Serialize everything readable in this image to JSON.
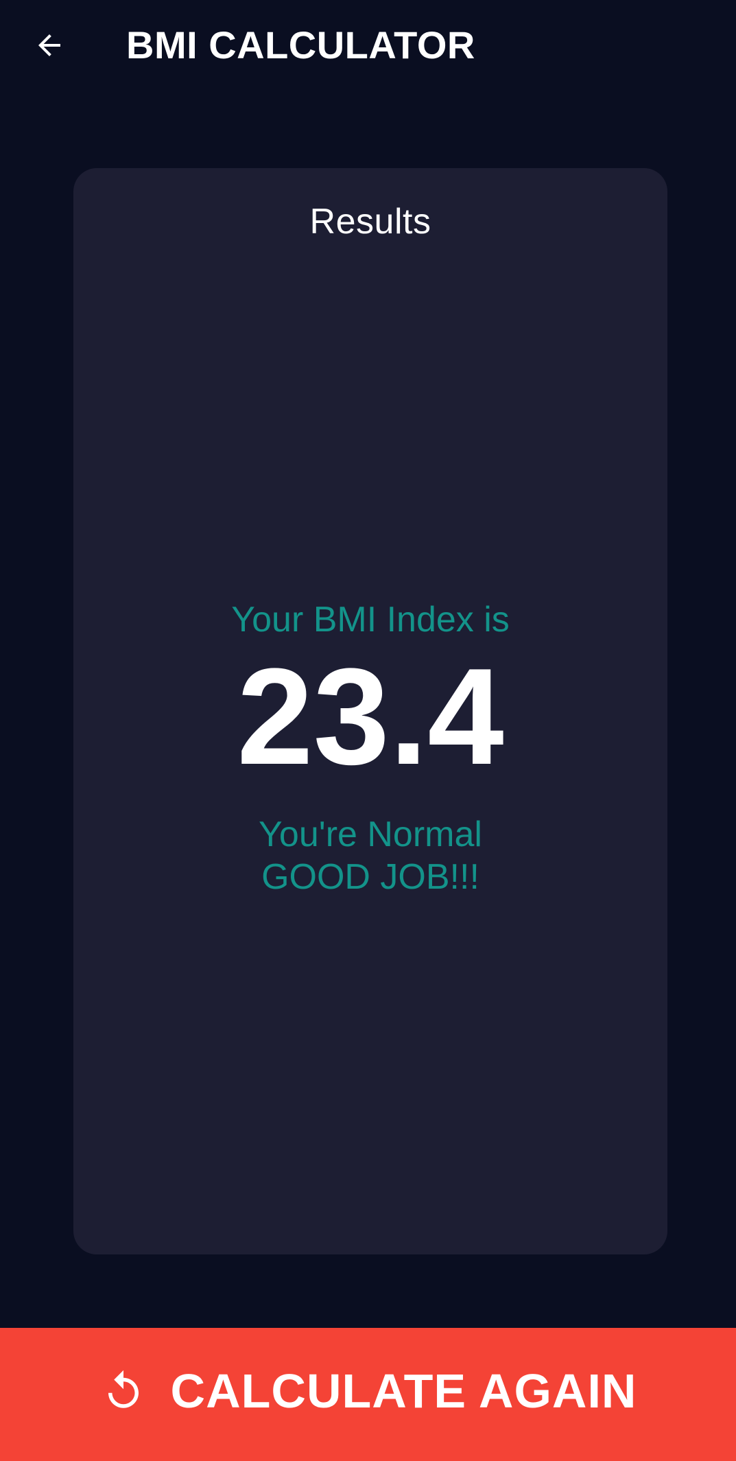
{
  "app_bar": {
    "title": "BMI CALCULATOR",
    "back_icon": "arrow-left-icon"
  },
  "result_card": {
    "heading": "Results",
    "bmi_label": "Your BMI Index is",
    "bmi_value": "23.4",
    "status_line_1": "You're Normal",
    "status_line_2": "GOOD JOB!!!"
  },
  "footer_button": {
    "label": "CALCULATE AGAIN",
    "icon": "refresh-icon"
  },
  "colors": {
    "background": "#0a0e21",
    "card": "#1d1e33",
    "accent_teal": "#13938a",
    "button": "#f44336",
    "text": "#ffffff"
  }
}
